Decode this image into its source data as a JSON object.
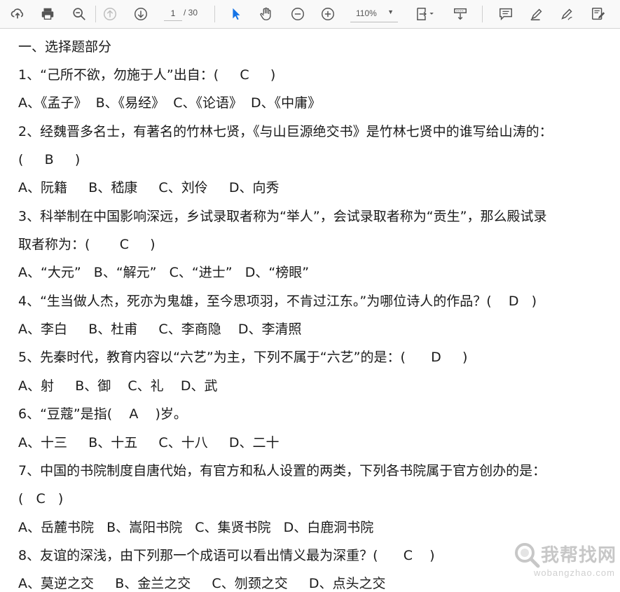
{
  "toolbar": {
    "icons": [
      "upload-icon",
      "print-icon",
      "zoom-out-search-icon",
      "previous-page-icon",
      "next-page-icon",
      "select-tool-icon",
      "hand-tool-icon",
      "zoom-out-icon",
      "zoom-in-icon",
      "fit-page-icon",
      "scroll-mode-icon",
      "comment-icon",
      "highlight-icon",
      "sign-icon",
      "fill-sign-icon"
    ],
    "page_current": "1",
    "page_total": "/ 30",
    "zoom_value": "110%"
  },
  "document": {
    "lines": [
      "一、选择题部分",
      "1、“己所不欲，勿施于人”出自：(     C     )",
      "A、《孟子》  B、《易经》  C、《论语》  D、《中庸》",
      "2、经魏晋多名士，有著名的竹林七贤，《与山巨源绝交书》是竹林七贤中的谁写给山涛的：",
      "(     B     )",
      "A、阮籍     B、嵇康     C、刘伶     D、向秀",
      "3、科举制在中国影响深远，乡试录取者称为“举人”，会试录取者称为“贡生”，那么殿试录",
      "取者称为：(       C     )",
      "A、“大元”   B、“解元”   C、“进士”   D、“榜眼”",
      "4、“生当做人杰，死亦为鬼雄，至今思项羽，不肯过江东。”为哪位诗人的作品？(    D   )",
      "A、李白     B、杜甫     C、李商隐    D、李清照",
      "5、先秦时代，教育内容以“六艺”为主，下列不属于“六艺”的是：(      D     )",
      "A、射     B、御    C、礼    D、武",
      "6、“豆蔻”是指(    A    )岁。",
      "A、十三     B、十五     C、十八     D、二十",
      "7、中国的书院制度自唐代始，有官方和私人设置的两类，下列各书院属于官方创办的是：",
      "(   C   )",
      "A、岳麓书院   B、嵩阳书院   C、集贤书院   D、白鹿洞书院",
      "8、友谊的深浅，由下列那一个成语可以看出情义最为深重？(      C    )",
      "A、莫逆之交     B、金兰之交     C、刎颈之交     D、点头之交"
    ]
  },
  "watermark": {
    "text": "我帮找网",
    "url": "wobangzhao.com"
  }
}
